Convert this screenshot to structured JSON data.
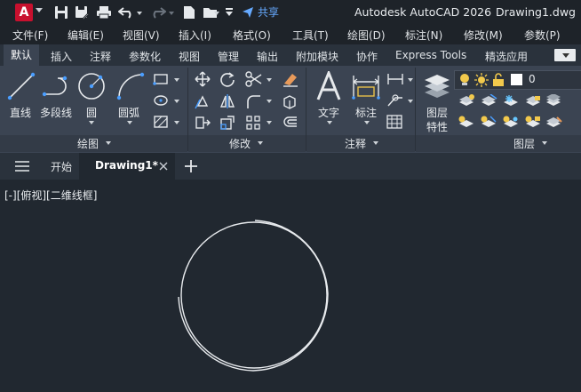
{
  "app": {
    "logo_letter": "A",
    "title": "Autodesk AutoCAD 2026",
    "document": "Drawing1.dwg",
    "share_label": "共享"
  },
  "menu": [
    "文件(F)",
    "编辑(E)",
    "视图(V)",
    "插入(I)",
    "格式(O)",
    "工具(T)",
    "绘图(D)",
    "标注(N)",
    "修改(M)",
    "参数(P)"
  ],
  "ribbon_tabs": [
    "默认",
    "插入",
    "注释",
    "参数化",
    "视图",
    "管理",
    "输出",
    "附加模块",
    "协作",
    "Express Tools",
    "精选应用"
  ],
  "active_tab": "默认",
  "draw_panel": {
    "tools": [
      "直线",
      "多段线",
      "圆",
      "圆弧"
    ],
    "footer": "绘图"
  },
  "modify_panel": {
    "footer": "修改"
  },
  "annotation_panel": {
    "tools": [
      "文字",
      "标注"
    ],
    "footer": "注释"
  },
  "layers_panel": {
    "tool_line1": "图层",
    "tool_line2": "特性",
    "current_layer": "0",
    "footer": "图层"
  },
  "file_tabs": {
    "start": "开始",
    "document": "Drawing1*"
  },
  "viewport": {
    "label": "[-][俯视][二维线框]"
  },
  "colors": {
    "accent_blue": "#4a9eff",
    "logo_red": "#c8102e",
    "canvas": "#212830",
    "ribbon": "#3b4452"
  }
}
